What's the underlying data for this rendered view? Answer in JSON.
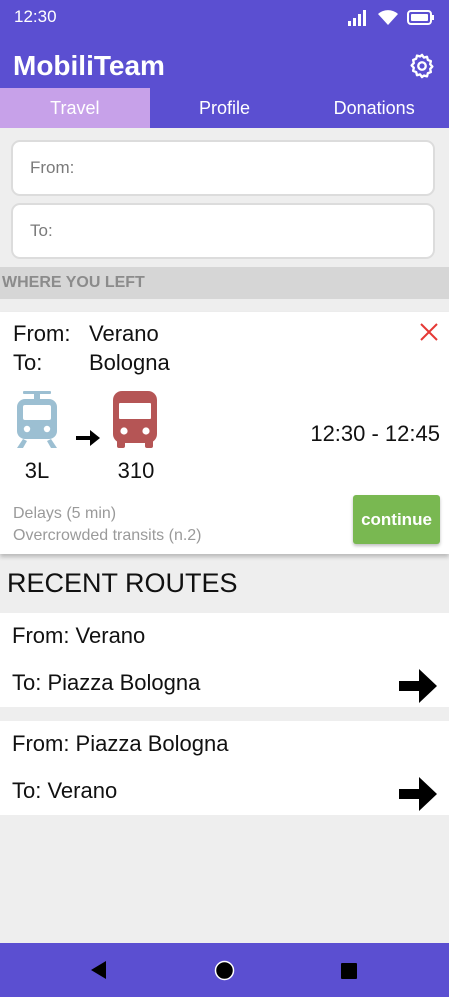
{
  "status_bar": {
    "time": "12:30"
  },
  "app": {
    "title": "MobiliTeam"
  },
  "tabs": [
    {
      "label": "Travel",
      "active": true
    },
    {
      "label": "Profile",
      "active": false
    },
    {
      "label": "Donations",
      "active": false
    }
  ],
  "search": {
    "from_placeholder": "From:",
    "to_placeholder": "To:"
  },
  "where_you_left": {
    "header": "WHERE YOU LEFT",
    "from_label": "From:",
    "from_value": "Verano",
    "to_label": "To:",
    "to_value": "Bologna",
    "leg1": {
      "vehicle": "tram-icon",
      "line": "3L",
      "color": "#9cbfd2"
    },
    "leg2": {
      "vehicle": "bus-icon",
      "line": "310",
      "color": "#b55555"
    },
    "time_range": "12:30 - 12:45",
    "warning_delay": "Delays (5 min)",
    "warning_crowd": "Overcrowded transits (n.2)",
    "continue_label": "continue",
    "continue_color": "#79b851",
    "close_color": "#e53935"
  },
  "recent_routes": {
    "title": "RECENT ROUTES",
    "items": [
      {
        "from": "From: Verano",
        "to": "To: Piazza Bologna"
      },
      {
        "from": "From: Piazza Bologna",
        "to": "To: Verano"
      }
    ]
  },
  "colors": {
    "primary": "#5b4fd1",
    "active_tab": "#c7a1e9"
  }
}
